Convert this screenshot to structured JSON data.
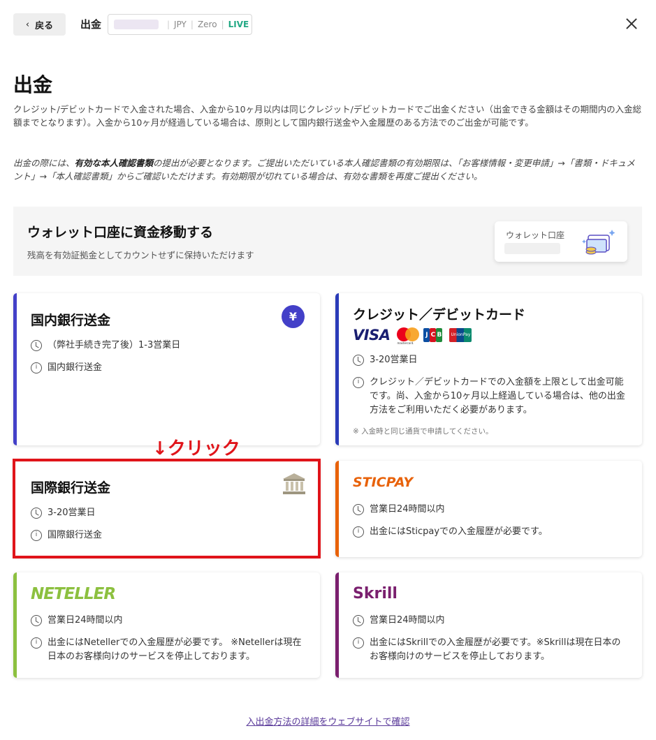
{
  "header": {
    "back_label": "戻る",
    "title": "出金",
    "account": {
      "currency": "JPY",
      "type": "Zero",
      "mode": "LIVE"
    }
  },
  "page": {
    "title": "出金",
    "intro": "クレジット/デビットカードで入金された場合、入金から10ヶ月以内は同じクレジット/デビットカードでご出金ください（出金できる金額はその期間内の入金総額までとなります）。入金から10ヶ月が経過している場合は、原則として国内銀行送金や入金履歴のある方法でのご出金が可能です。",
    "notice_pre": "出金の際には、",
    "notice_bold": "有効な本人確認書類",
    "notice_post": "の提出が必要となります。ご提出いただいている本人確認書類の有効期限は、「お客様情報・変更申請」→「書類・ドキュメント」→「本人確認書類」からご確認いただけます。有効期限が切れている場合は、有効な書類を再度ご提出ください。"
  },
  "wallet": {
    "title": "ウォレット口座に資金移動する",
    "description": "残高を有効証拠金としてカウントせずに保持いただけます",
    "card_label": "ウォレット口座"
  },
  "methods": {
    "domestic": {
      "title": "国内銀行送金",
      "time": "（弊社手続き完了後）1-3営業日",
      "info": "国内銀行送金",
      "icon_text": "¥"
    },
    "card": {
      "title": "クレジット／デビットカード",
      "time": "3-20営業日",
      "info": "クレジット／デビットカードでの入金額を上限として出金可能です。尚、入金から10ヶ月以上経過している場合は、他の出金方法をご利用いただく必要があります。",
      "note": "※ 入金時と同じ通貨で申請してください。",
      "visa": "VISA",
      "mastercard_text": "mastercard.",
      "unionpay_text": "UnionPay"
    },
    "international": {
      "title": "国際銀行送金",
      "time": "3-20営業日",
      "info": "国際銀行送金"
    },
    "sticpay": {
      "brand": "STICPAY",
      "time": "営業日24時間以内",
      "info": "出金にはSticpayでの入金履歴が必要です。"
    },
    "neteller": {
      "brand": "NETELLER",
      "time": "営業日24時間以内",
      "info": "出金にはNetellerでの入金履歴が必要です。 ※Netellerは現在日本のお客様向けのサービスを停止しております。"
    },
    "skrill": {
      "brand": "Skrill",
      "time": "営業日24時間以内",
      "info": "出金にはSkrillでの入金履歴が必要です。※Skrillは現在日本のお客様向けのサービスを停止しております。"
    }
  },
  "annotation": {
    "click_label": "↓クリック"
  },
  "footer": {
    "link": "入出金方法の詳細をウェブサイトで確認"
  },
  "colors": {
    "domestic_accent": "#4340c8",
    "card_accent": "#2a3bb8",
    "international_accent": "#e0141a",
    "sticpay_accent": "#e8620a",
    "neteller_accent": "#8cc03f",
    "skrill_accent": "#7a1f6e",
    "live": "#22a884"
  }
}
